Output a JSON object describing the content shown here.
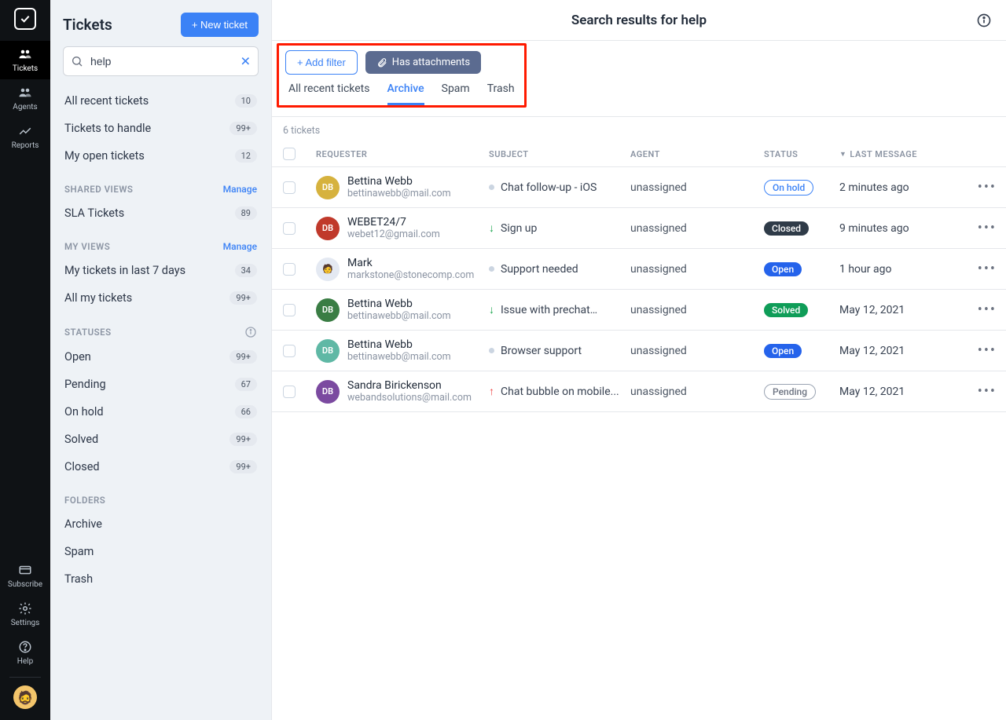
{
  "rail": {
    "items": [
      {
        "label": "Tickets",
        "icon": "people"
      },
      {
        "label": "Agents",
        "icon": "people"
      },
      {
        "label": "Reports",
        "icon": "chart"
      }
    ],
    "bottom": [
      {
        "label": "Subscribe",
        "icon": "card"
      },
      {
        "label": "Settings",
        "icon": "gear"
      },
      {
        "label": "Help",
        "icon": "help"
      }
    ]
  },
  "sidebar": {
    "title": "Tickets",
    "new_btn": "+ New ticket",
    "search_value": "help",
    "groups": {
      "top": [
        {
          "label": "All recent tickets",
          "count": "10"
        },
        {
          "label": "Tickets to handle",
          "count": "99+"
        },
        {
          "label": "My open tickets",
          "count": "12"
        }
      ],
      "shared_label": "SHARED VIEWS",
      "shared_manage": "Manage",
      "shared": [
        {
          "label": "SLA Tickets",
          "count": "89"
        }
      ],
      "myviews_label": "MY VIEWS",
      "myviews_manage": "Manage",
      "myviews": [
        {
          "label": "My tickets in last 7 days",
          "count": "34"
        },
        {
          "label": "All my tickets",
          "count": "99+"
        }
      ],
      "statuses_label": "STATUSES",
      "statuses": [
        {
          "label": "Open",
          "count": "99+"
        },
        {
          "label": "Pending",
          "count": "67"
        },
        {
          "label": "On hold",
          "count": "66"
        },
        {
          "label": "Solved",
          "count": "99+"
        },
        {
          "label": "Closed",
          "count": "99+"
        }
      ],
      "folders_label": "FOLDERS",
      "folders": [
        {
          "label": "Archive"
        },
        {
          "label": "Spam"
        },
        {
          "label": "Trash"
        }
      ]
    }
  },
  "main": {
    "title": "Search results for help",
    "add_filter": "+ Add filter",
    "chip": "Has attachments",
    "tabs": [
      "All recent tickets",
      "Archive",
      "Spam",
      "Trash"
    ],
    "active_tab": 1,
    "count": "6 tickets",
    "columns": {
      "requester": "REQUESTER",
      "subject": "SUBJECT",
      "agent": "AGENT",
      "status": "STATUS",
      "last": "LAST MESSAGE"
    },
    "rows": [
      {
        "name": "Bettina Webb",
        "email": "bettinawebb@mail.com",
        "avatar_bg": "#d6b23e",
        "avatar_tx": "DB",
        "pri": "dot",
        "subject": "Chat follow-up - iOS",
        "agent": "unassigned",
        "status": "On hold",
        "scls": "s-onhold",
        "time": "2 minutes ago"
      },
      {
        "name": "WEBET24/7",
        "email": "webet12@gmail.com",
        "avatar_bg": "#c0392b",
        "avatar_tx": "DB",
        "pri": "down",
        "subject": "Sign up",
        "agent": "unassigned",
        "status": "Closed",
        "scls": "s-closed",
        "time": "9 minutes ago"
      },
      {
        "name": "Mark",
        "email": "markstone@stonecomp.com",
        "avatar_bg": "#e4e9f2",
        "avatar_tx": "🧑",
        "pri": "dot",
        "subject": "Support needed",
        "agent": "unassigned",
        "status": "Open",
        "scls": "s-open",
        "time": "1 hour ago"
      },
      {
        "name": "Bettina Webb",
        "email": "bettinawebb@mail.com",
        "avatar_bg": "#3a7d44",
        "avatar_tx": "DB",
        "pri": "down",
        "subject": "Issue with prechat…",
        "agent": "unassigned",
        "status": "Solved",
        "scls": "s-solved",
        "time": "May 12, 2021"
      },
      {
        "name": "Bettina Webb",
        "email": "bettinawebb@mail.com",
        "avatar_bg": "#5fb8a5",
        "avatar_tx": "DB",
        "pri": "dot",
        "subject": "Browser support",
        "agent": "unassigned",
        "status": "Open",
        "scls": "s-open",
        "time": "May 12, 2021"
      },
      {
        "name": "Sandra Birickenson",
        "email": "webandsolutions@mail.com",
        "avatar_bg": "#7b4aa0",
        "avatar_tx": "DB",
        "pri": "up",
        "subject": "Chat bubble on mobile...",
        "agent": "unassigned",
        "status": "Pending",
        "scls": "s-pending",
        "time": "May 12, 2021"
      }
    ]
  }
}
